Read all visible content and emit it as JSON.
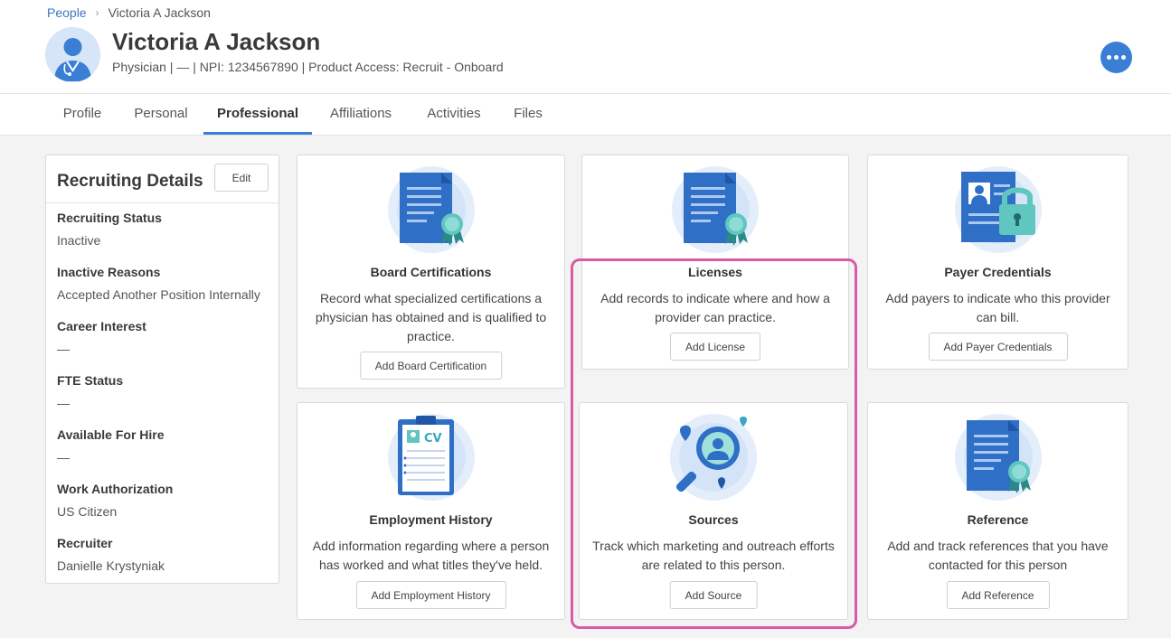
{
  "breadcrumb": {
    "link": "People",
    "current": "Victoria A Jackson"
  },
  "person": {
    "name": "Victoria A Jackson",
    "subtitle": "Physician | — | NPI: 1234567890 | Product Access: Recruit - Onboard"
  },
  "icons": {
    "more": "more-horizontal-icon",
    "avatar": "doctor-avatar-icon",
    "breadcrumb_sep": "chevron-right-icon"
  },
  "tabs": [
    {
      "label": "Profile"
    },
    {
      "label": "Personal"
    },
    {
      "label": "Professional",
      "active": true
    },
    {
      "label": "Affiliations"
    },
    {
      "label": "Activities"
    },
    {
      "label": "Files"
    }
  ],
  "recruiting": {
    "title": "Recruiting Details",
    "edit_label": "Edit",
    "fields": [
      {
        "label": "Recruiting Status",
        "value": "Inactive"
      },
      {
        "label": "Inactive Reasons",
        "value": "Accepted Another Position Internally"
      },
      {
        "label": "Career Interest",
        "value": "—"
      },
      {
        "label": "FTE Status",
        "value": "—"
      },
      {
        "label": "Available For Hire",
        "value": "—"
      },
      {
        "label": "Work Authorization",
        "value": "US Citizen"
      },
      {
        "label": "Recruiter",
        "value": "Danielle Krystyniak"
      }
    ]
  },
  "cards": [
    {
      "title": "Board Certifications",
      "description": "Record what specialized certifications a physician has obtained and is qualified to practice.",
      "button": "Add Board Certification",
      "icon": "certificate-icon"
    },
    {
      "title": "Licenses",
      "description": "Add records to indicate where and how a provider can practice.",
      "button": "Add License",
      "icon": "license-document-icon"
    },
    {
      "title": "Payer Credentials",
      "description": "Add payers to indicate who this provider can bill.",
      "button": "Add Payer Credentials",
      "icon": "locked-id-card-icon"
    },
    {
      "title": "Employment History",
      "description": "Add information regarding where a person has worked and what titles they've held.",
      "button": "Add Employment History",
      "icon": "cv-clipboard-icon",
      "icon_text": "CV"
    },
    {
      "title": "Sources",
      "description": "Track which marketing and outreach efforts are related to this person.",
      "button": "Add Source",
      "icon": "magnifier-person-icon"
    },
    {
      "title": "Reference",
      "description": "Add and track references that you have contacted for this person",
      "button": "Add Reference",
      "icon": "reference-document-icon"
    }
  ],
  "colors": {
    "accent": "#3a7fd5",
    "highlight": "#d85ca3",
    "link": "#3a78c2"
  }
}
